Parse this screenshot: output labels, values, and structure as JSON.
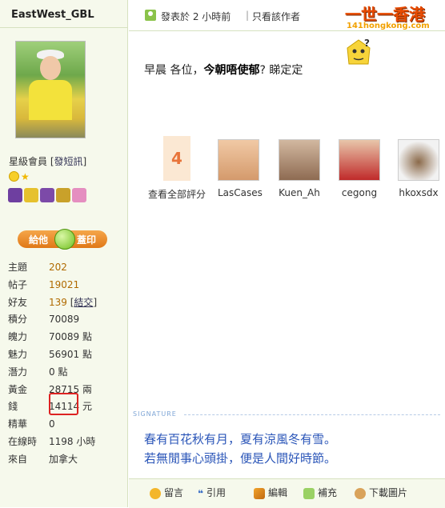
{
  "user": {
    "name": "EastWest_GBL",
    "rank_label": "星級會員",
    "send_msg": "發短訊",
    "give_left": "給他",
    "give_right": "蓋印"
  },
  "stats": [
    {
      "key": "主題",
      "value": "202"
    },
    {
      "key": "帖子",
      "value": "19021"
    },
    {
      "key": "好友",
      "value": "139",
      "extra": "結交"
    },
    {
      "key": "積分",
      "value": "70089"
    },
    {
      "key": "魄力",
      "value": "70089 點"
    },
    {
      "key": "魅力",
      "value": "56901 點"
    },
    {
      "key": "潛力",
      "value": "0 點"
    },
    {
      "key": "黃金",
      "value": "28715 兩"
    },
    {
      "key": "錢",
      "value": "14114 元"
    },
    {
      "key": "精華",
      "value": "0"
    },
    {
      "key": "在線時",
      "value": "1198 小時"
    },
    {
      "key": "來自",
      "value": "加拿大"
    }
  ],
  "post": {
    "posted": "發表於 2 小時前",
    "separator": "|",
    "only_author": "只看該作者",
    "content_pre": "早晨 各位，",
    "content_bold": "今朝唔使郁",
    "content_post": "? 睇定定"
  },
  "logo": {
    "big": "一世一香港",
    "small": "141hongkong.com"
  },
  "rating": {
    "count": "4",
    "view_all": "查看全部評分",
    "raters": [
      "LasCases",
      "Kuen_Ah",
      "cegong",
      "hkoxsdx"
    ]
  },
  "signature": {
    "label": "SIGNATURE",
    "line1": "春有百花秋有月，夏有涼風冬有雪。",
    "line2": "若無閒事心頭掛，便是人間好時節。"
  },
  "footer": {
    "reply": "留言",
    "quote": "引用",
    "edit": "編輯",
    "supplement": "補充",
    "download": "下載圖片"
  },
  "icons": [
    "user-icon",
    "question-face-icon",
    "smile-icon",
    "star-icon",
    "comment-icon",
    "quote-icon",
    "pencil-icon",
    "add-icon",
    "download-icon"
  ]
}
